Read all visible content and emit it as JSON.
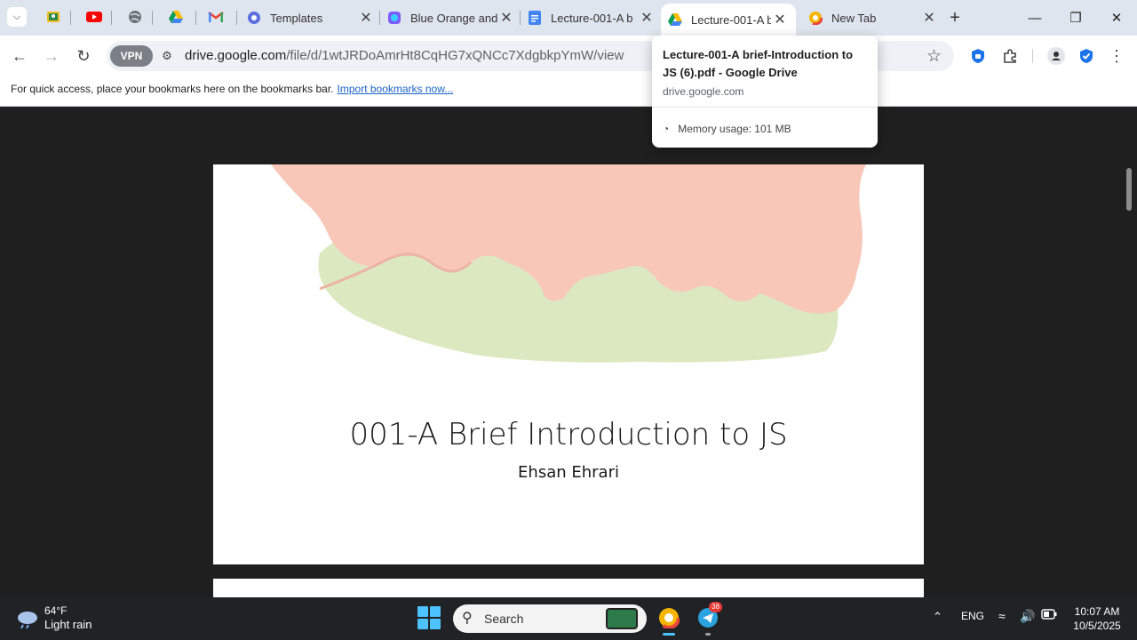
{
  "tabs": [
    {
      "title": "Templates",
      "favicon": "canva-icon"
    },
    {
      "title": "Blue Orange and",
      "favicon": "design-icon"
    },
    {
      "title": "Lecture-001-A b",
      "favicon": "docs-icon"
    },
    {
      "title": "Lecture-001-A b",
      "favicon": "drive-icon",
      "active": true
    },
    {
      "title": "New Tab",
      "favicon": "browser-icon"
    }
  ],
  "address_bar": {
    "vpn_label": "VPN",
    "domain": "drive.google.com",
    "path": "/file/d/1wtJRDoAmrHt8CqHG7xQNCc7XdgbkpYmW/view"
  },
  "bookmarks_bar": {
    "message": "For quick access, place your bookmarks here on the bookmarks bar.",
    "import_link": "Import bookmarks now..."
  },
  "hover_card": {
    "title": "Lecture-001-A brief-Introduction to JS (6).pdf - Google Drive",
    "domain": "drive.google.com",
    "memory": "Memory usage: 101 MB"
  },
  "document": {
    "slide_title": "001-A Brief Introduction to JS",
    "author": "Ehsan Ehrari"
  },
  "taskbar": {
    "temperature": "64°F",
    "condition": "Light rain",
    "search_label": "Search",
    "telegram_badge": "38",
    "language": "ENG",
    "time": "10:07 AM",
    "date": "10/5/2025"
  },
  "colors": {
    "accent_blue": "#1a73e8",
    "paint_pink": "#f8c7b8",
    "paint_green": "#dbe8c0"
  }
}
